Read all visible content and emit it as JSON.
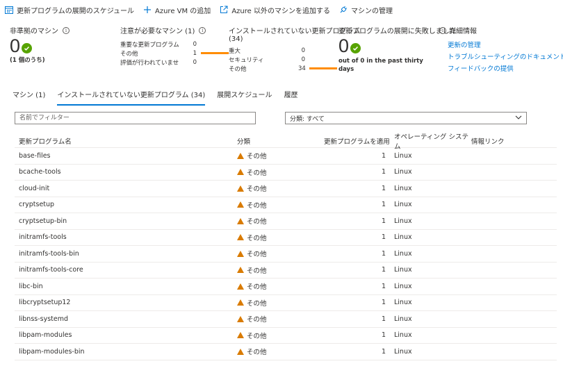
{
  "toolbar": {
    "schedule": "更新プログラムの展開のスケジュール",
    "add_azure_vm": "Azure VM の追加",
    "add_non_azure": "Azure 以外のマシンを追加する",
    "manage_machines": "マシンの管理"
  },
  "cards": {
    "noncompliant": {
      "title": "非準拠のマシン",
      "value": "0",
      "sub": "(1 個のうち)"
    },
    "attention": {
      "title": "注意が必要なマシン (1)",
      "rows": [
        {
          "label": "重要な更新プログラム",
          "value": "0",
          "fraction": 0
        },
        {
          "label": "その他",
          "value": "1",
          "fraction": 1
        },
        {
          "label": "評価が行われていませ",
          "value": "0",
          "fraction": 0
        }
      ]
    },
    "missing": {
      "title": "インストールされていない更新プログラム",
      "title2": "(34)",
      "rows": [
        {
          "label": "重大",
          "value": "0",
          "fraction": 0
        },
        {
          "label": "セキュリティ",
          "value": "0",
          "fraction": 0
        },
        {
          "label": "その他",
          "value": "34",
          "fraction": 1
        }
      ]
    },
    "failed": {
      "title": "更新プログラムの展開に失敗しました",
      "value": "0",
      "sub": "out of 0 in the past thirty days"
    },
    "details": {
      "title": "詳細情報",
      "links": [
        "更新の管理",
        "トラブルシューティングのドキュメント",
        "フィードバックの提供"
      ]
    }
  },
  "tabs": [
    {
      "label": "マシン (1)",
      "active": false
    },
    {
      "label": "インストールされていない更新プログラム (34)",
      "active": true
    },
    {
      "label": "展開スケジュール",
      "active": false
    },
    {
      "label": "履歴",
      "active": false
    }
  ],
  "filter": {
    "placeholder": "名前でフィルター"
  },
  "classification": {
    "value": "分類: すべて"
  },
  "table": {
    "headers": [
      "更新プログラム名",
      "分類",
      "更新プログラムを適用して...",
      "オペレーティング システム",
      "情報リンク"
    ],
    "rows": [
      {
        "name": "base-files",
        "class": "その他",
        "count": "1",
        "os": "Linux"
      },
      {
        "name": "bcache-tools",
        "class": "その他",
        "count": "1",
        "os": "Linux"
      },
      {
        "name": "cloud-init",
        "class": "その他",
        "count": "1",
        "os": "Linux"
      },
      {
        "name": "cryptsetup",
        "class": "その他",
        "count": "1",
        "os": "Linux"
      },
      {
        "name": "cryptsetup-bin",
        "class": "その他",
        "count": "1",
        "os": "Linux"
      },
      {
        "name": "initramfs-tools",
        "class": "その他",
        "count": "1",
        "os": "Linux"
      },
      {
        "name": "initramfs-tools-bin",
        "class": "その他",
        "count": "1",
        "os": "Linux"
      },
      {
        "name": "initramfs-tools-core",
        "class": "その他",
        "count": "1",
        "os": "Linux"
      },
      {
        "name": "libc-bin",
        "class": "その他",
        "count": "1",
        "os": "Linux"
      },
      {
        "name": "libcryptsetup12",
        "class": "その他",
        "count": "1",
        "os": "Linux"
      },
      {
        "name": "libnss-systemd",
        "class": "その他",
        "count": "1",
        "os": "Linux"
      },
      {
        "name": "libpam-modules",
        "class": "その他",
        "count": "1",
        "os": "Linux"
      },
      {
        "name": "libpam-modules-bin",
        "class": "その他",
        "count": "1",
        "os": "Linux"
      }
    ]
  },
  "colors": {
    "accent": "#0078d4",
    "success": "#57a300",
    "warning": "#d97b00",
    "bar": "#ff8c00"
  },
  "icons": [
    "calendar-icon",
    "plus-icon",
    "external-link-icon",
    "plug-icon",
    "info-icon",
    "check-circle-icon",
    "warning-icon",
    "chevron-down-icon"
  ]
}
